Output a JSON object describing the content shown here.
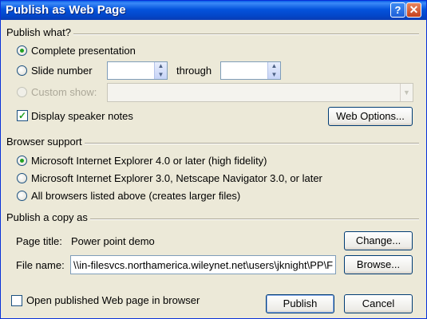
{
  "window": {
    "title": "Publish as Web Page",
    "help_glyph": "?",
    "close_glyph": "✕"
  },
  "publish_what": {
    "heading": "Publish what?",
    "complete_presentation": "Complete presentation",
    "slide_number": "Slide number",
    "through": "through",
    "custom_show": "Custom show:",
    "display_speaker_notes": "Display speaker notes",
    "web_options_button": "Web Options...",
    "slide_from_value": "",
    "slide_to_value": "",
    "custom_show_value": "",
    "selected": "complete_presentation",
    "speaker_notes_checked": true
  },
  "browser_support": {
    "heading": "Browser support",
    "options": [
      "Microsoft Internet Explorer 4.0 or later (high fidelity)",
      "Microsoft Internet Explorer 3.0, Netscape Navigator 3.0, or later",
      "All browsers listed above (creates larger files)"
    ],
    "selected_index": 0
  },
  "publish_copy": {
    "heading": "Publish a copy as",
    "page_title_label": "Page title:",
    "page_title_value": "Power point demo",
    "change_button": "Change...",
    "file_name_label": "File name:",
    "file_name_value": "\\\\in-filesvcs.northamerica.wileynet.net\\users\\jknight\\PP\\F",
    "browse_button": "Browse..."
  },
  "footer": {
    "open_in_browser": "Open published Web page in browser",
    "open_in_browser_checked": false,
    "publish_button": "Publish",
    "cancel_button": "Cancel"
  },
  "icons": {
    "spin_up": "▲",
    "spin_down": "▼",
    "combo": "▼",
    "check": "✓"
  }
}
